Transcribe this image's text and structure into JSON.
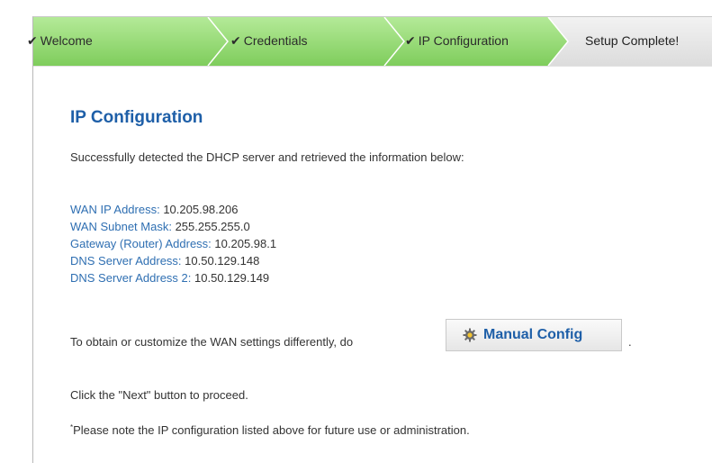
{
  "wizard": {
    "steps": [
      {
        "label": "Welcome",
        "check": "✔",
        "state": "done"
      },
      {
        "label": "Credentials",
        "check": "✔",
        "state": "done"
      },
      {
        "label": "IP Configuration",
        "check": "✔",
        "state": "done"
      },
      {
        "label": "Setup Complete!",
        "check": "",
        "state": "pending"
      }
    ],
    "colors": {
      "done": "#8fd870",
      "pending": "#e4e4e4"
    }
  },
  "page": {
    "title": "IP Configuration",
    "intro": "Successfully detected the DHCP server and retrieved the information below:",
    "info": [
      {
        "label": "WAN IP Address:",
        "value": "10.205.98.206"
      },
      {
        "label": "WAN Subnet Mask:",
        "value": "255.255.255.0"
      },
      {
        "label": "Gateway (Router) Address:",
        "value": "10.205.98.1"
      },
      {
        "label": "DNS Server Address:",
        "value": "10.50.129.148"
      },
      {
        "label": "DNS Server Address 2:",
        "value": "10.50.129.149"
      }
    ],
    "obtain_text": "To obtain or customize the WAN settings differently, do",
    "manual_button": {
      "label": "Manual Config",
      "icon": "gear-icon"
    },
    "trailing_dot": ".",
    "next_text": "Click the \"Next\" button to proceed.",
    "note_marker": "*",
    "note_text": "Please note the IP configuration listed above for future use or administration."
  }
}
